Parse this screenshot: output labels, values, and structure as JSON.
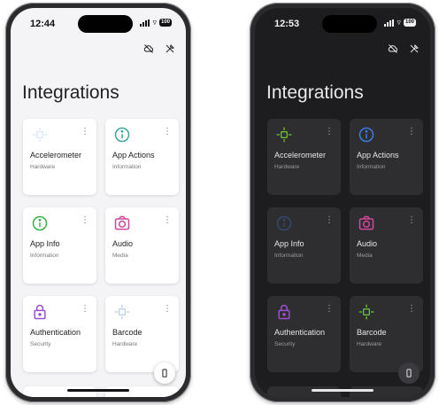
{
  "colors": {
    "green": "#6cc12a",
    "teal": "#3ba79b",
    "blue": "#3d7be0",
    "pink": "#d0479b",
    "purple": "#9a4fd1",
    "light_blue": "#9ebde6"
  },
  "light": {
    "time": "12:44",
    "battery": "100",
    "title": "Integrations",
    "cards": [
      {
        "name": "Accelerometer",
        "category": "Hardware",
        "icon": "accelerometer-icon"
      },
      {
        "name": "App Actions",
        "category": "Information",
        "icon": "info-icon"
      },
      {
        "name": "App Info",
        "category": "Information",
        "icon": "info-icon"
      },
      {
        "name": "Audio",
        "category": "Media",
        "icon": "camera-icon"
      },
      {
        "name": "Authentication",
        "category": "Security",
        "icon": "lock-icon"
      },
      {
        "name": "Barcode",
        "category": "Hardware",
        "icon": "barcode-icon"
      }
    ]
  },
  "dark": {
    "time": "12:53",
    "battery": "100",
    "title": "Integrations",
    "cards": [
      {
        "name": "Accelerometer",
        "category": "Hardware",
        "icon": "accelerometer-icon"
      },
      {
        "name": "App Actions",
        "category": "Information",
        "icon": "info-icon"
      },
      {
        "name": "App Info",
        "category": "Information",
        "icon": "info-icon"
      },
      {
        "name": "Audio",
        "category": "Media",
        "icon": "camera-icon"
      },
      {
        "name": "Authentication",
        "category": "Security",
        "icon": "lock-icon"
      },
      {
        "name": "Barcode",
        "category": "Hardware",
        "icon": "barcode-icon"
      }
    ]
  }
}
